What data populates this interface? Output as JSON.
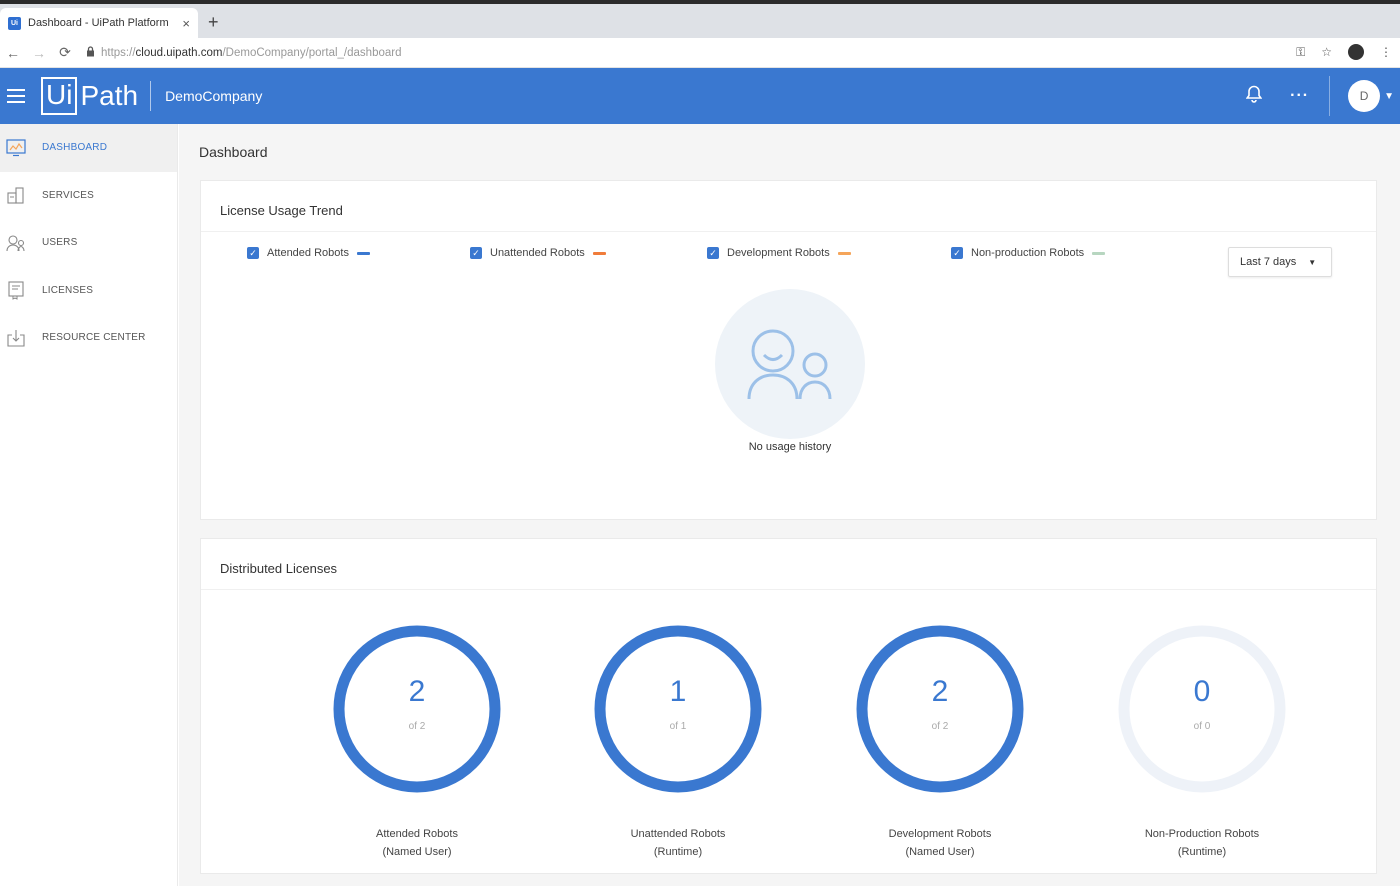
{
  "browser": {
    "tab_title": "Dashboard - UiPath Platform",
    "favicon_text": "Ui",
    "new_tab": "+",
    "tab_close": "×",
    "url_prefix": "https://",
    "url_host": "cloud.uipath.com",
    "url_path": "/DemoCompany/portal_/dashboard"
  },
  "header": {
    "logo_ui": "Ui",
    "logo_path": "Path",
    "company": "DemoCompany",
    "more": "···",
    "avatar_initial": "D"
  },
  "sidebar": {
    "items": [
      {
        "label": "DASHBOARD",
        "icon": "dashboard-icon",
        "active": true
      },
      {
        "label": "SERVICES",
        "icon": "services-icon",
        "active": false
      },
      {
        "label": "USERS",
        "icon": "users-icon",
        "active": false
      },
      {
        "label": "LICENSES",
        "icon": "licenses-icon",
        "active": false
      },
      {
        "label": "RESOURCE CENTER",
        "icon": "resource-center-icon",
        "active": false
      }
    ]
  },
  "main": {
    "page_title": "Dashboard",
    "trend_card": {
      "title": "License Usage Trend",
      "legend": [
        {
          "label": "Attended Robots",
          "checked": true,
          "color": "#3a78d0"
        },
        {
          "label": "Unattended Robots",
          "checked": true,
          "color": "#f07c3a"
        },
        {
          "label": "Development Robots",
          "checked": true,
          "color": "#f5a55a"
        },
        {
          "label": "Non-production Robots",
          "checked": true,
          "color": "#b7d6c0"
        }
      ],
      "range": "Last 7 days",
      "empty_text": "No usage history"
    },
    "licenses_card": {
      "title": "Distributed Licenses",
      "items": [
        {
          "value": "2",
          "of": "of 2",
          "label_line1": "Attended Robots",
          "label_line2": "(Named User)",
          "fraction": 1
        },
        {
          "value": "1",
          "of": "of 1",
          "label_line1": "Unattended Robots",
          "label_line2": "(Runtime)",
          "fraction": 1
        },
        {
          "value": "2",
          "of": "of 2",
          "label_line1": "Development Robots",
          "label_line2": "(Named User)",
          "fraction": 1
        },
        {
          "value": "0",
          "of": "of 0",
          "label_line1": "Non-Production Robots",
          "label_line2": "(Runtime)",
          "fraction": 0
        }
      ]
    }
  },
  "colors": {
    "brand": "#3a78d0",
    "donut_track": "#eef2f8"
  }
}
